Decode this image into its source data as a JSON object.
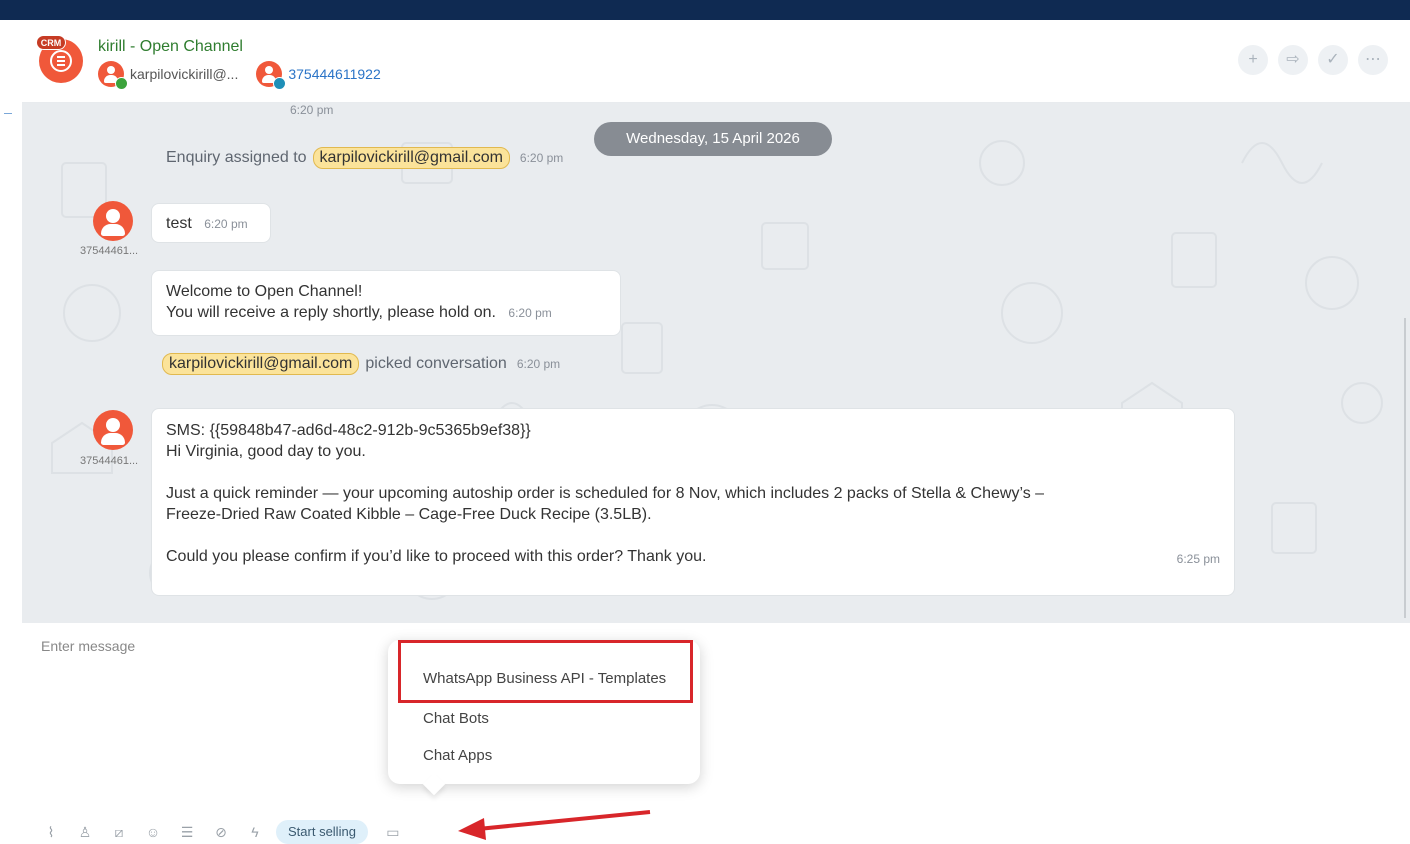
{
  "header": {
    "crm_badge": "CRM",
    "title": "kirill - Open Channel",
    "user_email_short": "karpilovickirill@...",
    "phone": "375444611922",
    "actions": [
      "plus-icon",
      "forward-icon",
      "check-icon",
      "more-icon"
    ]
  },
  "chat": {
    "top_time": "6:20 pm",
    "date_label": "Wednesday, 15 April 2026",
    "assigned": {
      "prefix": "Enquiry assigned to",
      "email": "karpilovickirill@gmail.com",
      "time": "6:20 pm"
    },
    "msg_test": {
      "text": "test",
      "time": "6:20 pm",
      "sender": "37544461..."
    },
    "welcome": {
      "line1": "Welcome to Open Channel!",
      "line2": "You will receive a reply shortly, please hold on.",
      "time": "6:20 pm"
    },
    "picked": {
      "email": "karpilovickirill@gmail.com",
      "suffix": "picked conversation",
      "time": "6:20 pm"
    },
    "sms": {
      "sender": "37544461...",
      "line1": "SMS: {{59848b47-ad6d-48c2-912b-9c5365b9ef38}}",
      "line2": "Hi Virginia, good day to you.",
      "line3": "Just a quick reminder — your upcoming autoship order is scheduled for 8 Nov, which includes 2 packs of Stella & Chewy’s –",
      "line4": "Freeze-Dried Raw Coated Kibble – Cage-Free Duck Recipe (3.5LB).",
      "line5": "Could you please confirm if you’d like to proceed with this order? Thank you.",
      "time": "6:25 pm"
    }
  },
  "composer": {
    "placeholder": "Enter message",
    "start_selling": "Start selling",
    "tools": [
      "paperclip-icon",
      "user-icon",
      "slash-command-icon",
      "emoji-icon",
      "list-icon",
      "hidden-icon",
      "lightning-icon"
    ]
  },
  "popup_menu": {
    "items": [
      "WhatsApp Business API - Templates",
      "Chat Bots",
      "Chat Apps"
    ]
  },
  "colors": {
    "top_bar": "#0f2a52",
    "title_green": "#2f7d2f",
    "avatar_orange": "#f0583a",
    "highlight_red": "#d8262a"
  }
}
